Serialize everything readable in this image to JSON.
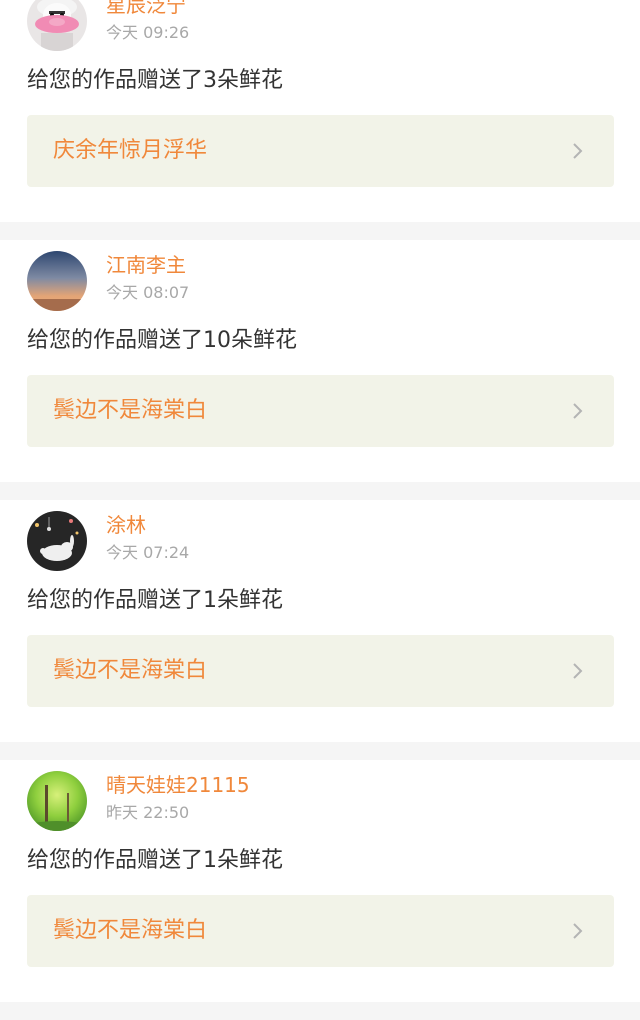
{
  "gifts": [
    {
      "username": "星辰泛宁",
      "time": "今天 09:26",
      "message": "给您的作品赠送了3朵鲜花",
      "work_title": "庆余年惊月浮华",
      "avatar_icon": "cartoon-character-avatar-icon"
    },
    {
      "username": "江南李主",
      "time": "今天 08:07",
      "message": "给您的作品赠送了10朵鲜花",
      "work_title": "鬓边不是海棠白",
      "avatar_icon": "sunset-sky-avatar-icon"
    },
    {
      "username": "涂林",
      "time": "今天 07:24",
      "message": "给您的作品赠送了1朵鲜花",
      "work_title": "鬓边不是海棠白",
      "avatar_icon": "rabbit-night-avatar-icon"
    },
    {
      "username": "晴天娃娃21115",
      "time": "昨天 22:50",
      "message": "给您的作品赠送了1朵鲜花",
      "work_title": "鬓边不是海棠白",
      "avatar_icon": "green-forest-avatar-icon"
    }
  ],
  "colors": {
    "accent": "#f0883b",
    "link_background": "#f2f3e8",
    "time_text": "#a8a8a8",
    "body_text": "#333333",
    "divider": "#f5f5f5"
  }
}
